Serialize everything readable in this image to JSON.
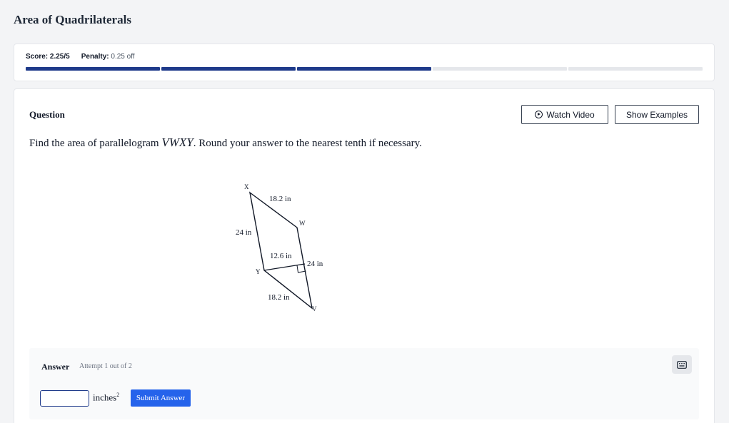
{
  "page": {
    "title": "Area of Quadrilaterals"
  },
  "score": {
    "score_label": "Score:",
    "score_value": "2.25/5",
    "penalty_label": "Penalty:",
    "penalty_value": "0.25 off",
    "progress": {
      "segments": 5,
      "filled": 3
    },
    "colors": {
      "filled": "#1e3a8a",
      "empty": "#e5e7eb"
    }
  },
  "question": {
    "label": "Question",
    "text_before": "Find the area of parallelogram",
    "math_name": "VWXY",
    "text_after": ". Round your answer to the nearest tenth if necessary.",
    "buttons": {
      "watch_video": "Watch Video",
      "show_examples": "Show Examples"
    }
  },
  "figure": {
    "vertices": {
      "x": "X",
      "w": "W",
      "y": "Y",
      "v": "V"
    },
    "labels": {
      "top_side": "18.2 in",
      "left_side": "24 in",
      "height": "12.6 in",
      "right_side": "24 in",
      "bottom_side": "18.2 in"
    }
  },
  "answer": {
    "label": "Answer",
    "attempt": "Attempt 1 out of 2",
    "input_value": "",
    "unit": "inches",
    "unit_exponent": "2",
    "submit_label": "Submit Answer",
    "accent_color": "#2563eb"
  }
}
